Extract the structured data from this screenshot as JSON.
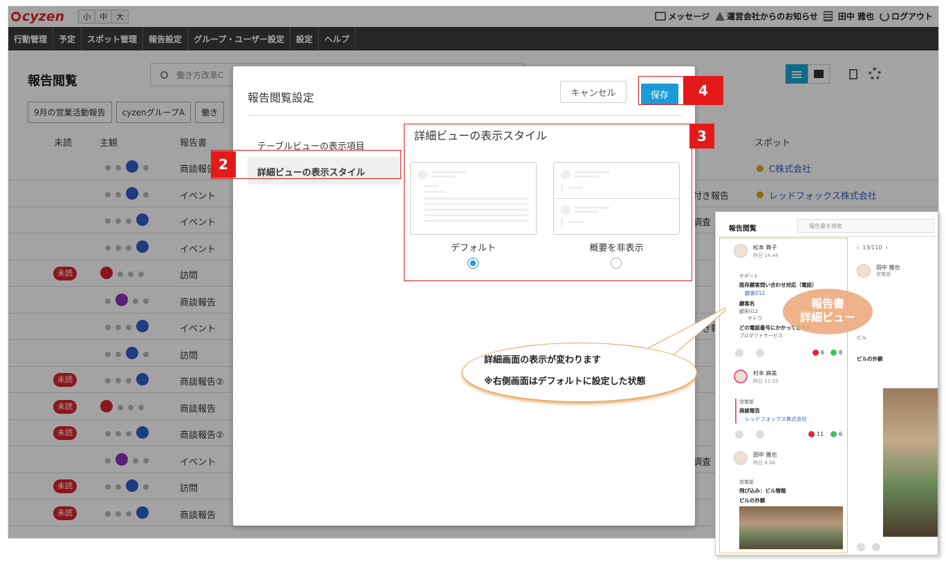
{
  "topbar": {
    "logo": "cyzen",
    "font_sizes": [
      "小",
      "中",
      "大"
    ],
    "messages": "メッセージ",
    "notice": "運営会社からのお知らせ",
    "user": "田中 雅也",
    "logout": "ログアウト"
  },
  "nav": [
    "行動管理",
    "予定",
    "スポット管理",
    "報告設定",
    "グループ・ユーザー設定",
    "設定",
    "ヘルプ"
  ],
  "page": {
    "title": "報告閲覧",
    "search_value": "働き方改革C",
    "filters": [
      "9月の営業活動報告",
      "cyzenグループA",
      "働き"
    ],
    "columns": {
      "unread": "未読",
      "subjective": "主観",
      "report": "報告書",
      "spot": "スポット"
    }
  },
  "rows": [
    {
      "unread": "",
      "mood": "up",
      "type": "商談報告",
      "spot": "C株式会社",
      "side": ""
    },
    {
      "unread": "",
      "mood": "up",
      "type": "イベント",
      "spot": "レッドフォックス株式会社",
      "side": "付き報告"
    },
    {
      "unread": "",
      "mood": "up2",
      "type": "イベント",
      "spot": "",
      "side": "調査"
    },
    {
      "unread": "",
      "mood": "up2",
      "type": "イベント",
      "spot": "",
      "side": ""
    },
    {
      "unread": "未読",
      "mood": "heart",
      "type": "訪問",
      "spot": "",
      "side": ""
    },
    {
      "unread": "",
      "mood": "down",
      "type": "商談報告",
      "spot": "",
      "side": ""
    },
    {
      "unread": "",
      "mood": "up2",
      "type": "イベント",
      "spot": "",
      "side": "付き報"
    },
    {
      "unread": "",
      "mood": "up",
      "type": "訪問",
      "spot": "",
      "side": ""
    },
    {
      "unread": "未読",
      "mood": "up2",
      "type": "商談報告②",
      "spot": "",
      "side": ""
    },
    {
      "unread": "未読",
      "mood": "heart",
      "type": "商談報告",
      "spot": "",
      "side": ""
    },
    {
      "unread": "未読",
      "mood": "up2",
      "type": "商談報告②",
      "spot": "",
      "side": ""
    },
    {
      "unread": "",
      "mood": "down",
      "type": "イベント",
      "spot": "",
      "side": "調査"
    },
    {
      "unread": "未読",
      "mood": "up",
      "type": "訪問",
      "spot": "",
      "side": ""
    },
    {
      "unread": "未読",
      "mood": "up2",
      "type": "商談報告",
      "spot": "",
      "side": ""
    }
  ],
  "modal": {
    "title": "報告閲覧設定",
    "cancel": "キャンセル",
    "save": "保存",
    "menu": [
      "テーブルビューの表示項目",
      "詳細ビューの表示スタイル"
    ],
    "section_title": "詳細ビューの表示スタイル",
    "options": [
      {
        "label": "デフォルト",
        "selected": true
      },
      {
        "label": "概要を非表示",
        "selected": false
      }
    ]
  },
  "markers": [
    "2",
    "3",
    "4"
  ],
  "callout": [
    "詳細画面の表示が変わります",
    "※右側画面はデフォルトに設定した状態"
  ],
  "preview": {
    "title": "報告閲覧",
    "search_placeholder": "報告書を検索",
    "bubble": [
      "報告書",
      "詳細ビュー"
    ],
    "pager": "13/110",
    "entries": [
      {
        "name": "松本 典子",
        "time": "昨日 14:44",
        "dept": "サポート",
        "report": "既存顧客問い合わせ対応（電話）",
        "spot": "顧客012",
        "f1": "顧客名",
        "v1": "顧客012",
        "v1b": "サトウ",
        "f2": "どの電話番号にかかってきたか",
        "v2": "プロダクトサービス",
        "likes": "6",
        "comments": "8"
      },
      {
        "name": "村本 麻美",
        "time": "昨日 11:33",
        "dept": "営業部",
        "report": "商談報告",
        "spot": "レッドフォックス株式会社",
        "likes": "11",
        "comments": "6"
      },
      {
        "name": "田中 雅也",
        "time": "昨日 9:36",
        "dept": "営業部",
        "report": "飛び込み：ビル情報",
        "f1": "ビルの外観"
      }
    ],
    "detail": {
      "name": "田中 雅也",
      "dept": "営業部",
      "label1": "ビル",
      "label2": "ビルの外観"
    }
  },
  "colors": {
    "accent": "#1a9ad6",
    "nav": "#3c3c3c",
    "unread": "#d9232e",
    "annotation": "#e41a1a"
  }
}
